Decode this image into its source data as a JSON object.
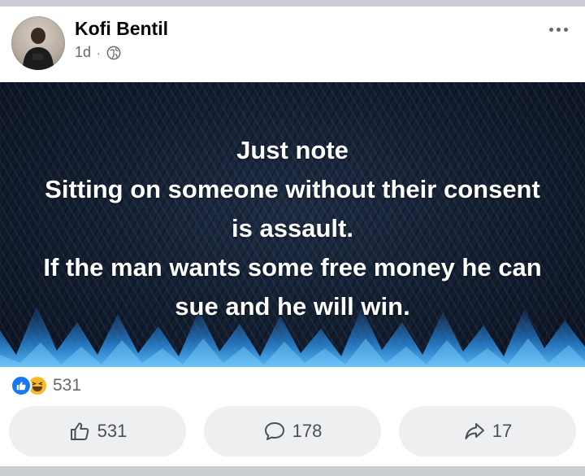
{
  "post": {
    "author": "Kofi Bentil",
    "time": "1d",
    "separator": "·",
    "privacy_icon": "globe-icon",
    "more_icon": "more-options-icon",
    "text_lines": [
      "Just note",
      "Sitting on someone without their consent",
      "is assault.",
      "If the man wants some free money he can",
      "sue and he will win."
    ],
    "background_colors": {
      "base": "#121d30",
      "flame": "#2a8ee6",
      "text": "#ffffff"
    }
  },
  "reactions": {
    "icons": [
      "like-icon",
      "haha-icon"
    ],
    "count": "531"
  },
  "actions": {
    "like": {
      "icon": "thumbs-up-icon",
      "count": "531"
    },
    "comment": {
      "icon": "comment-icon",
      "count": "178"
    },
    "share": {
      "icon": "share-icon",
      "count": "17"
    }
  },
  "colors": {
    "accent": "#1877f2",
    "button_bg": "#eeeff1",
    "muted_text": "#65676b",
    "haha": "#f7b928"
  }
}
